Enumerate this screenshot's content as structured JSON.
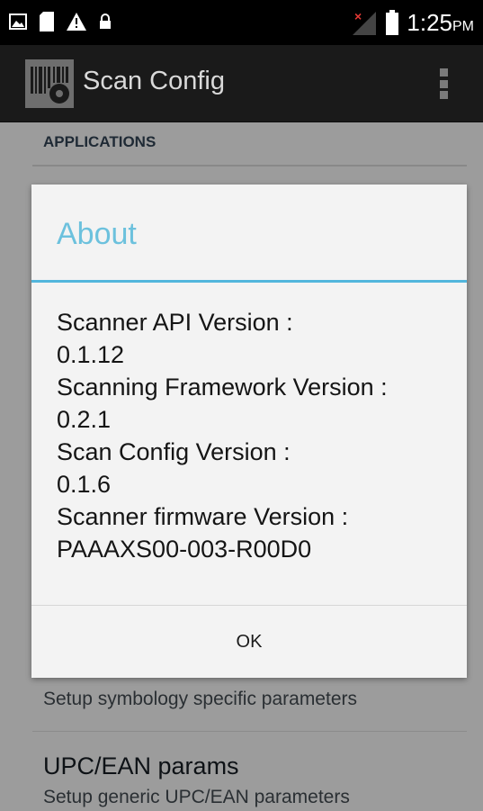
{
  "status_bar": {
    "time": "1:25",
    "ampm": "PM",
    "icons": [
      "picture-icon",
      "sd-card-icon",
      "warning-icon",
      "lock-icon",
      "no-signal-icon",
      "battery-icon"
    ]
  },
  "action_bar": {
    "title": "Scan Config",
    "icon": "barcode-gear-icon",
    "menu_icon": "overflow-menu-icon"
  },
  "background": {
    "section_header": "APPLICATIONS",
    "items": [
      {
        "description": "Setup symbology specific parameters"
      },
      {
        "title": "UPC/EAN params",
        "description": "Setup generic UPC/EAN parameters"
      }
    ]
  },
  "dialog": {
    "title": "About",
    "lines": [
      "Scanner API Version :",
      "0.1.12",
      "Scanning Framework Version :",
      "0.2.1",
      "Scan Config Version :",
      "0.1.6",
      "Scanner firmware Version :",
      "PAAAXS00-003-R00D0"
    ],
    "ok_label": "OK"
  },
  "colors": {
    "accent": "#52b6dc",
    "title_text": "#6cc1dd",
    "dim_background": "#9c9c9c"
  }
}
